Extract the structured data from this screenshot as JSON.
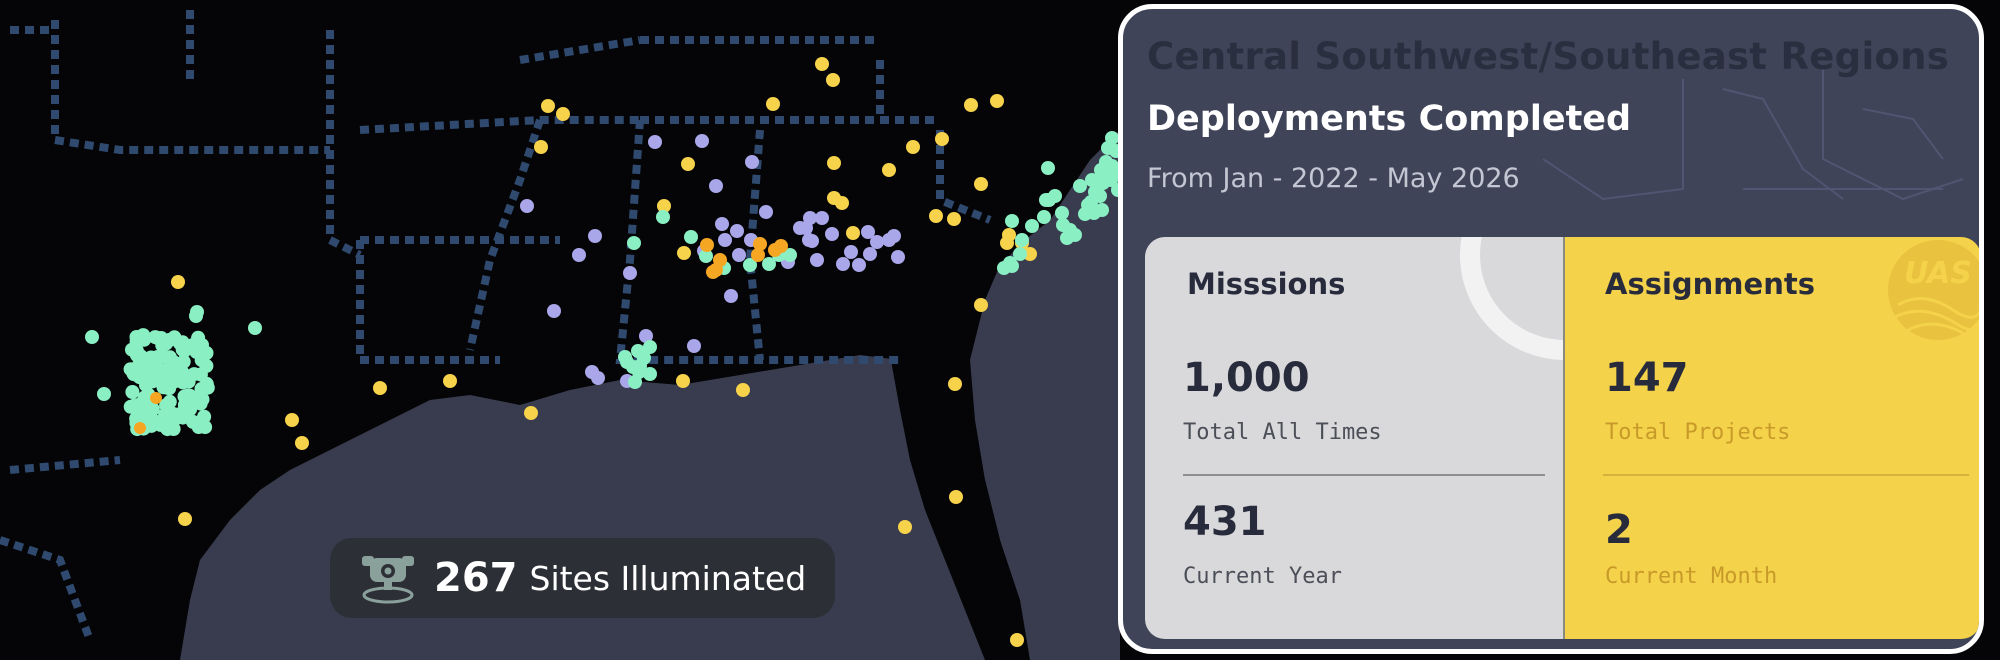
{
  "map": {
    "sites_count": "267",
    "sites_label": "Sites Illuminated",
    "marker_colors": {
      "mint": "#8af0c4",
      "lavender": "#a9a7ea",
      "yellow": "#f7d24b",
      "orange": "#f5a623"
    }
  },
  "panel": {
    "region_title": "Central Southwest/Southeast Regions",
    "heading": "Deployments Completed",
    "date_range": "From Jan - 2022 - May 2026",
    "missions": {
      "title": "Misssions",
      "total_value": "1,000",
      "total_label": "Total All Times",
      "year_value": "431",
      "year_label": "Current Year"
    },
    "assignments": {
      "title": "Assignments",
      "total_value": "147",
      "total_label": "Total Projects",
      "month_value": "2",
      "month_label": "Current Month"
    },
    "colors": {
      "panel_bg": "#3f4458",
      "missions_bg": "#d9d9dc",
      "assignments_bg": "#f4d24a",
      "accent_label": "#c89a2a"
    }
  }
}
